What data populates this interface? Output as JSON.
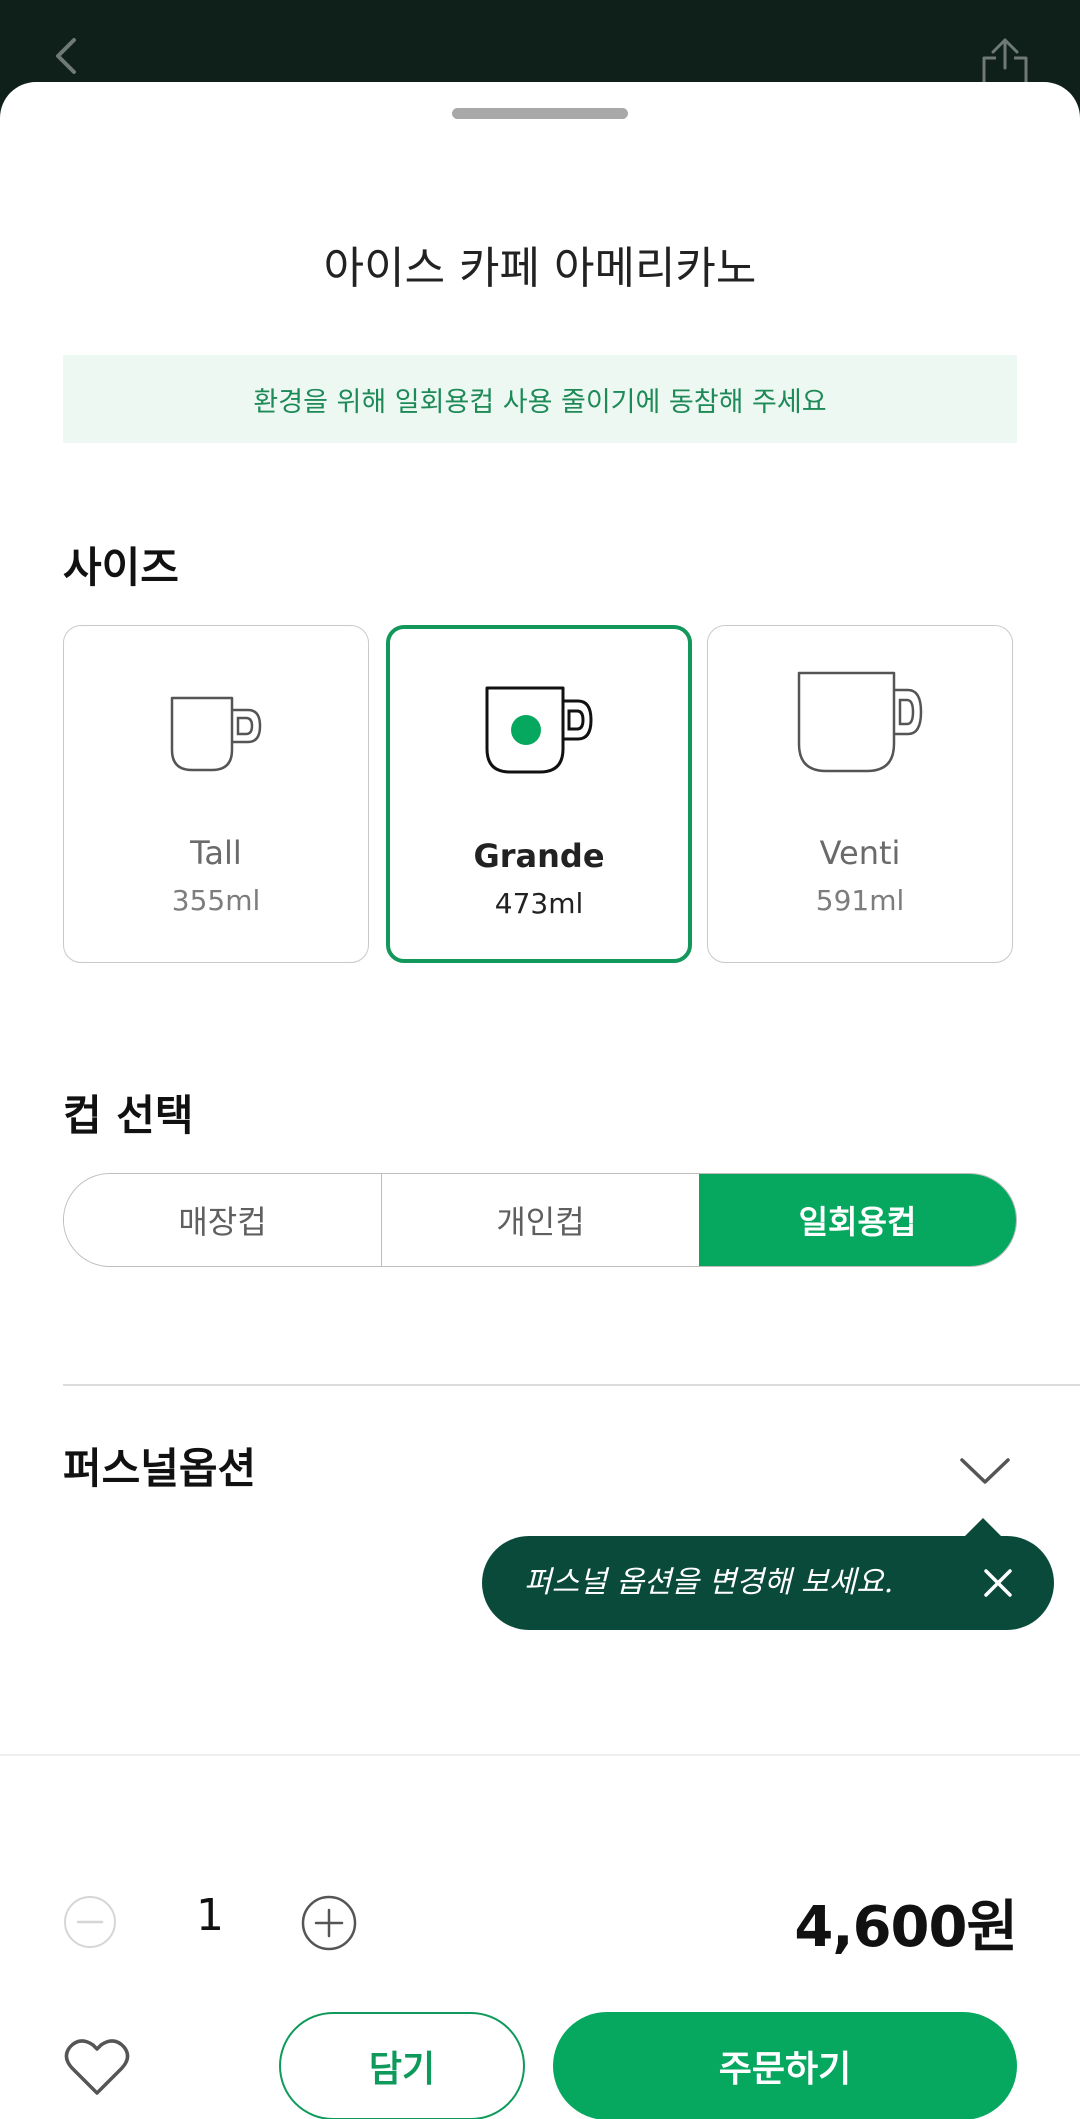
{
  "title": "아이스 카페 아메리카노",
  "eco_banner": "환경을 위해 일회용컵 사용 줄이기에 동참해 주세요",
  "size_section": {
    "title": "사이즈",
    "options": [
      {
        "name": "Tall",
        "volume": "355ml"
      },
      {
        "name": "Grande",
        "volume": "473ml"
      },
      {
        "name": "Venti",
        "volume": "591ml"
      }
    ],
    "selected": "Grande"
  },
  "cup_section": {
    "title": "컵 선택",
    "options": [
      "매장컵",
      "개인컵",
      "일회용컵"
    ],
    "selected": "일회용컵"
  },
  "personal_section": {
    "title": "퍼스널옵션",
    "tooltip": "퍼스널 옵션을 변경해 보세요."
  },
  "order": {
    "quantity": "1",
    "price": "4,600원",
    "cart_label": "담기",
    "order_label": "주문하기"
  },
  "colors": {
    "accent": "#06a860",
    "tooltip_bg": "#0a4a3a",
    "banner_bg": "#eef8f3",
    "banner_text": "#1d8a57"
  },
  "icons": [
    "back-icon",
    "share-icon",
    "cup-icon",
    "chevron-down-icon",
    "close-icon",
    "minus-icon",
    "plus-icon",
    "heart-icon"
  ]
}
